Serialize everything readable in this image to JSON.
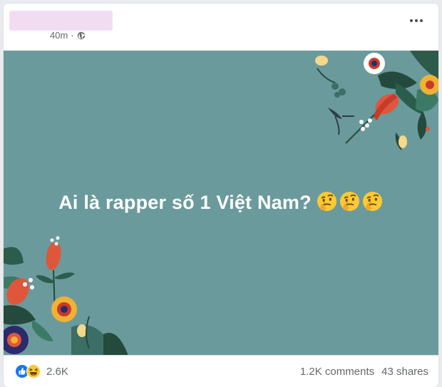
{
  "post": {
    "timestamp": "40m",
    "text": "Ai là rapper số 1 Việt Nam?",
    "emoji_icons": [
      "thinking-face-icon",
      "thinking-face-icon",
      "thinking-face-icon"
    ],
    "background_color": "#6b9a9c"
  },
  "footer": {
    "reaction_icons": [
      "like-icon",
      "haha-icon"
    ],
    "reaction_count": "2.6K",
    "comments": "1.2K comments",
    "shares": "43 shares"
  }
}
